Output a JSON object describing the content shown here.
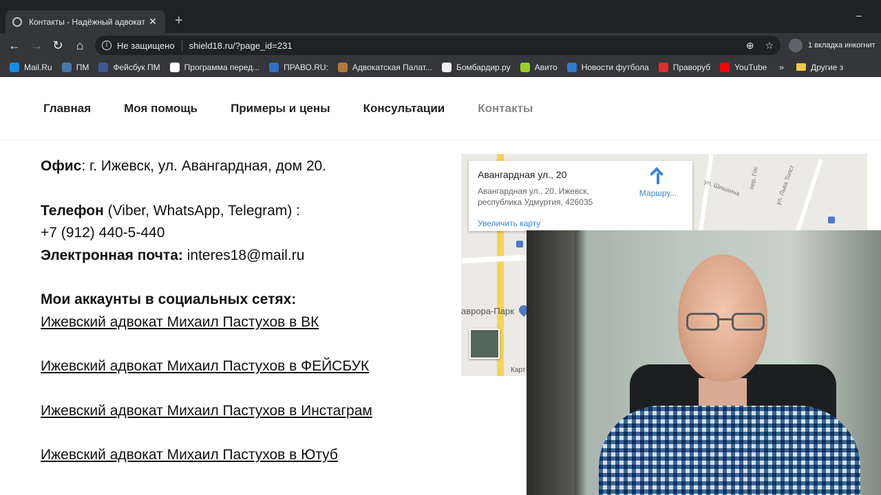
{
  "browser": {
    "tab": {
      "title": "Контакты - Надёжный адвокат"
    },
    "new_tab": "+",
    "window_minimize": "–",
    "address": {
      "security": "Не защищено",
      "url": "shield18.ru/?page_id=231"
    },
    "incognito": "1 вкладка инкогнит",
    "bookmarks": [
      {
        "label": "Mail.Ru",
        "color": "#168de2"
      },
      {
        "label": "ПМ",
        "color": "#4a76a8"
      },
      {
        "label": "Фейсбук ПМ",
        "color": "#3b5998"
      },
      {
        "label": "Программа перед...",
        "color": "#ffffff"
      },
      {
        "label": "ПРАВО.RU:",
        "color": "#2e6fc7"
      },
      {
        "label": "Адвокатская Палат...",
        "color": "#b07a3b"
      },
      {
        "label": "Бомбардир.ру",
        "color": "#eeeeee"
      },
      {
        "label": "Авито",
        "color": "#97cf26"
      },
      {
        "label": "Новости футбола",
        "color": "#2d7bd1"
      },
      {
        "label": "Праворуб",
        "color": "#e52b2b"
      },
      {
        "label": "YouTube",
        "color": "#ff0000"
      }
    ],
    "bookmarks_more": "»",
    "other_bookmarks": "Другие з"
  },
  "nav": {
    "items": [
      "Главная",
      "Моя помощь",
      "Примеры и цены",
      "Консультации",
      "Контакты"
    ]
  },
  "contacts": {
    "office_label": "Офис",
    "office_value": ": г. Ижевск, ул. Авангардная, дом 20.",
    "phone_label": "Телефон",
    "phone_note": " (Viber, WhatsApp, Telegram) :",
    "phone_value": "+7 (912) 440-5-440",
    "email_label": "Электронная почта:",
    "email_value": " interes18@mail.ru",
    "social_heading": "Мои аккаунты в социальных сетях:",
    "links": [
      "Ижевский адвокат Михаил Пастухов в ВК",
      "Ижевский адвокат Михаил Пастухов в ФЕЙСБУК",
      "Ижевский адвокат Михаил Пастухов в Инстаграм",
      "Ижевский адвокат Михаил Пастухов в Ютуб"
    ]
  },
  "map": {
    "card_title": "Авангардная ул., 20",
    "card_address": "Авангардная ул., 20, Ижевск, республика Удмуртия, 426035",
    "enlarge": "Увеличить карту",
    "route": "Маршру...",
    "place": "аврора-Парк",
    "street_1": "ул. Шишкина",
    "street_2": "ул. Льва Толст",
    "street_3": "пер. Гос",
    "credit": "Карт"
  }
}
